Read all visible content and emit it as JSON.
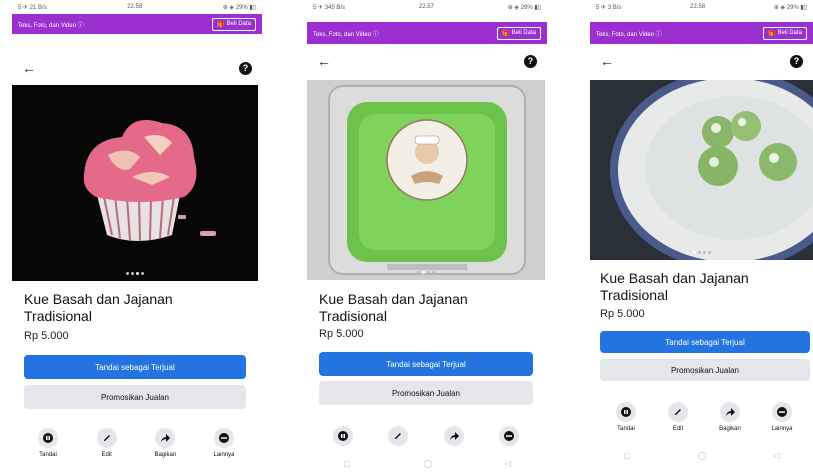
{
  "screens": [
    {
      "status_left": "5 ✈ 21 B/s",
      "status_time": "22.58",
      "status_right": "⊕ ◈ 29% ▮▯",
      "topbar_text": "Teks, Foto, dan Video ⓘ",
      "buy_label": "Beli Data",
      "title": "Kue Basah dan Jajanan Tradisional",
      "price": "Rp 5.000",
      "primary_label": "Tandai sebagai Terjual",
      "secondary_label": "Promosikan Jualan",
      "actions": [
        "Tandai",
        "Edit",
        "Bagikan",
        "Lainnya"
      ]
    },
    {
      "status_left": "5 ✈ 345 B/s",
      "status_time": "22.57",
      "status_right": "⊕ ◈ 29% ▮▯",
      "topbar_text": "Teks, Foto, dan Video ⓘ",
      "buy_label": "Beli Data",
      "title": "Kue Basah dan Jajanan Tradisional",
      "price": "Rp 5.000",
      "primary_label": "Tandai sebagai Terjual",
      "secondary_label": "Promosikan Jualan"
    },
    {
      "status_left": "5 ✈ 3 B/s",
      "status_time": "22.58",
      "status_right": "⊕ ◈ 29% ▮▯",
      "topbar_text": "Teks, Foto, dan Video ⓘ",
      "buy_label": "Beli Data",
      "title": "Kue Basah dan Jajanan Tradisional",
      "price": "Rp 5.000",
      "primary_label": "Tandai sebagai Terjual",
      "secondary_label": "Promosikan Jualan",
      "actions": [
        "Tandai",
        "Edit",
        "Bagikan",
        "Lainnya"
      ]
    }
  ],
  "colors": {
    "purple": "#9b2fd0",
    "blue": "#2374e1",
    "gray_button": "#e4e6eb"
  },
  "icons": [
    "back-arrow-icon",
    "help-icon",
    "gift-icon",
    "pause-icon",
    "pencil-icon",
    "share-icon",
    "more-icon"
  ]
}
